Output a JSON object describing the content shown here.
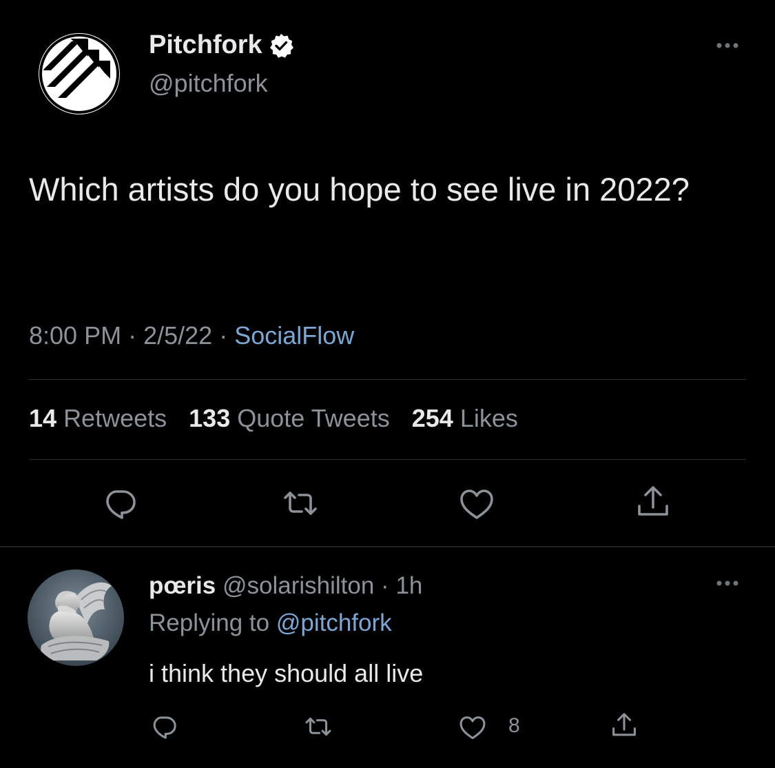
{
  "tweet": {
    "author_name": "Pitchfork",
    "author_handle": "@pitchfork",
    "text": "Which artists do you hope to see live in 2022?",
    "time": "8:00 PM",
    "date": "2/5/22",
    "source": "SocialFlow",
    "separator": "·",
    "stats": {
      "retweets_count": "14",
      "retweets_label": "Retweets",
      "quotes_count": "133",
      "quotes_label": "Quote Tweets",
      "likes_count": "254",
      "likes_label": "Likes"
    },
    "icons": {
      "avatar": "pitchfork-logo",
      "verified": "verified-badge-icon",
      "more": "more-icon",
      "reply": "reply-icon",
      "retweet": "retweet-icon",
      "like": "heart-icon",
      "share": "share-icon"
    }
  },
  "reply": {
    "author_name": "pœris",
    "author_handle": "@solarishilton",
    "separator": "·",
    "age": "1h",
    "replying_to_label": "Replying to",
    "replying_to_handle": "@pitchfork",
    "text": "i think they should all live",
    "like_count": "8"
  },
  "colors": {
    "background": "#000000",
    "primary_text": "#e7e9ea",
    "secondary_text": "#8b9298",
    "link": "#7aa8d6",
    "divider": "#2b2f33"
  }
}
